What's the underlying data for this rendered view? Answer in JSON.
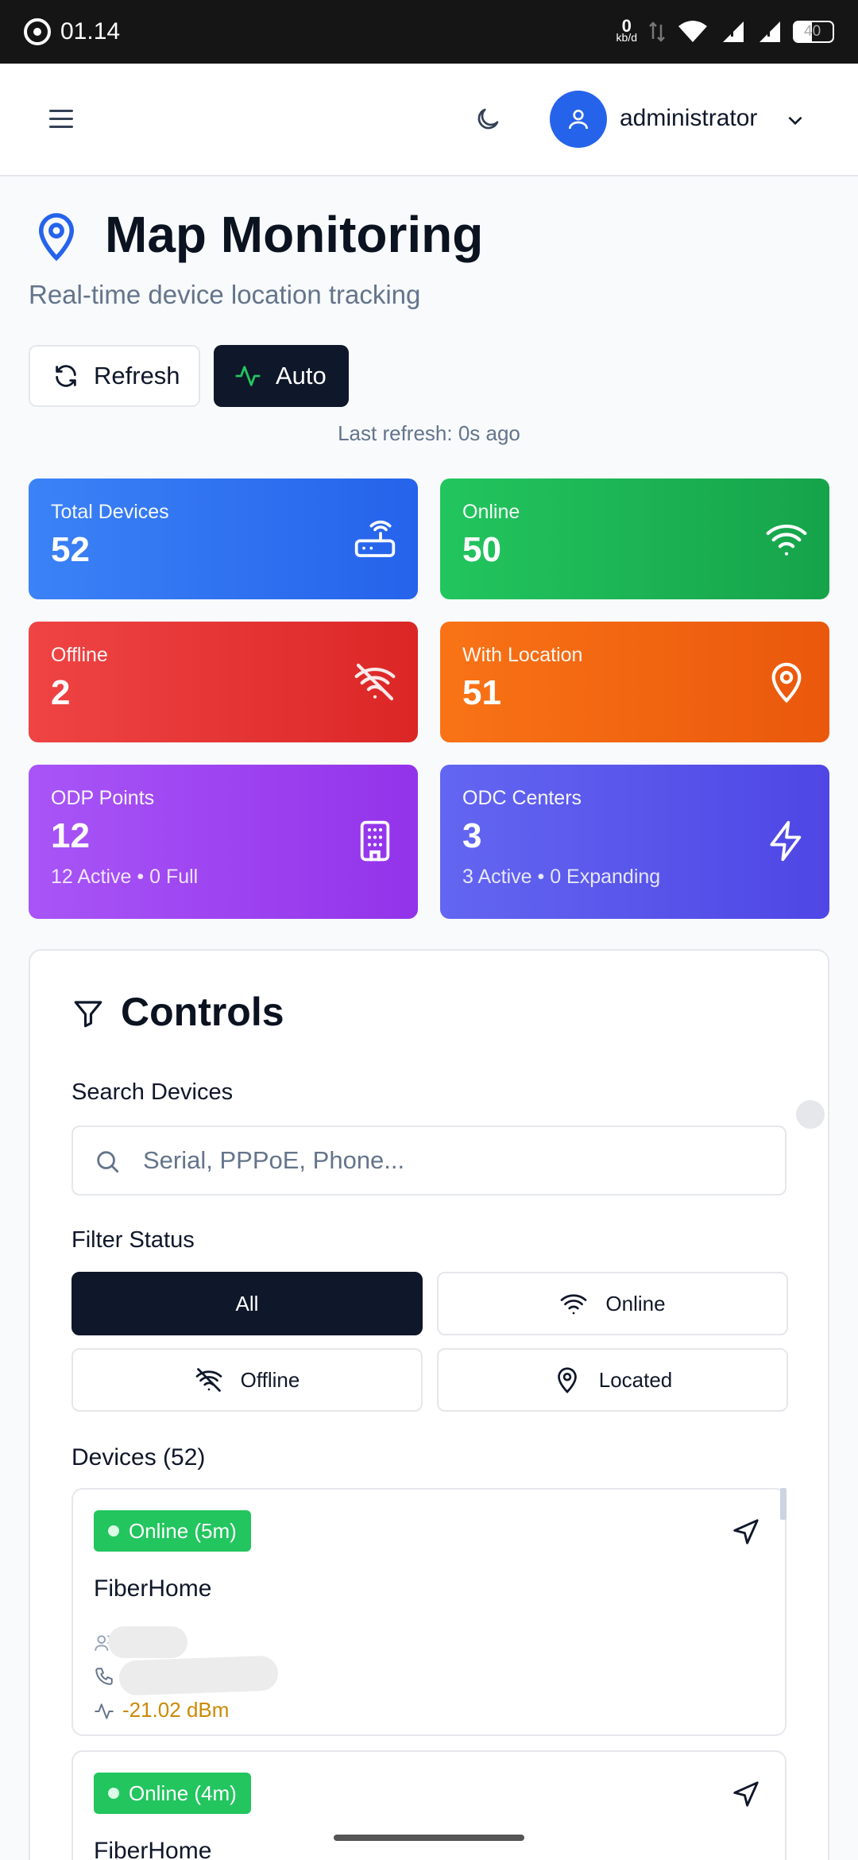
{
  "status_bar": {
    "time": "01.14",
    "net_speed": "0",
    "net_unit": "kb/d",
    "battery": "40"
  },
  "header": {
    "user_name": "administrator"
  },
  "page": {
    "title": "Map Monitoring",
    "subtitle": "Real-time device location tracking"
  },
  "actions": {
    "refresh_label": "Refresh",
    "auto_label": "Auto",
    "last_refresh": "Last refresh: 0s ago"
  },
  "stats": [
    {
      "label": "Total Devices",
      "value": "52",
      "icon": "router-icon",
      "color": "#2563eb"
    },
    {
      "label": "Online",
      "value": "50",
      "icon": "wifi-icon",
      "color": "#16a34a"
    },
    {
      "label": "Offline",
      "value": "2",
      "icon": "wifi-off-icon",
      "color": "#dc2626"
    },
    {
      "label": "With Location",
      "value": "51",
      "icon": "map-pin-icon",
      "color": "#ea580c"
    },
    {
      "label": "ODP Points",
      "value": "12",
      "sub": "12 Active • 0 Full",
      "icon": "building-icon",
      "color": "#9333ea"
    },
    {
      "label": "ODC Centers",
      "value": "3",
      "sub": "3 Active • 0 Expanding",
      "icon": "zap-icon",
      "color": "#4f46e5"
    }
  ],
  "controls": {
    "title": "Controls",
    "search_label": "Search Devices",
    "search_placeholder": "Serial, PPPoE, Phone...",
    "search_value": "",
    "filter_label": "Filter Status",
    "filters": [
      {
        "label": "All",
        "active": true
      },
      {
        "label": "Online",
        "icon": "wifi-icon"
      },
      {
        "label": "Offline",
        "icon": "wifi-off-icon"
      },
      {
        "label": "Located",
        "icon": "map-pin-icon"
      }
    ],
    "devices_label": "Devices (52)"
  },
  "devices": [
    {
      "status": "Online (5m)",
      "name": "FiberHome",
      "signal": "-21.02 dBm"
    },
    {
      "status": "Online (4m)",
      "name": "FiberHome"
    }
  ]
}
